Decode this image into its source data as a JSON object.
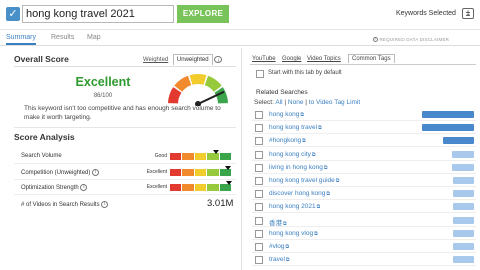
{
  "header": {
    "search_value": "hong kong travel 2021",
    "explore_label": "EXPLORE",
    "keywords_selected_label": "Keywords Selected",
    "keywords_selected_count": "1"
  },
  "tabs": [
    "Summary",
    "Results",
    "Map"
  ],
  "disclaimer": "REQUIRED DATA DISCLAIMER",
  "overall": {
    "title": "Overall Score",
    "weighted_label": "Weighted",
    "unweighted_label": "Unweighted",
    "rating": "Excellent",
    "score": "86/100",
    "score_value": 86,
    "description": "This keyword isn't too competitive and has enough search volume to make it worth targeting."
  },
  "analysis": {
    "title": "Score Analysis",
    "rows": [
      {
        "label": "Search Volume",
        "rating": "Good",
        "level": 0.74
      },
      {
        "label": "Competition (Unweighted)",
        "rating": "Excellent",
        "level": 0.93
      },
      {
        "label": "Optimization Strength",
        "rating": "Excellent",
        "level": 0.95
      }
    ],
    "videos_label": "# of Videos in Search Results",
    "videos_value": "3.01M"
  },
  "right": {
    "tabs": [
      "YouTube",
      "Google",
      "Video Topics",
      "Common Tags"
    ],
    "start_label": "Start with this tab by default",
    "related_title": "Related Searches",
    "select_prefix": "Select:",
    "select_all": "All",
    "select_sep": "|",
    "select_none": "None",
    "select_limit": "to Video Tag Limit",
    "keywords": [
      {
        "text": "hong kong",
        "vol": 1.0,
        "ext": true
      },
      {
        "text": "hong kong travel",
        "vol": 1.0,
        "ext": true
      },
      {
        "text": "#hongkong",
        "vol": 0.6,
        "ext": true
      },
      {
        "text": "hong kong city",
        "vol": 0.42,
        "ext": true
      },
      {
        "text": "living in hong kong",
        "vol": 0.42,
        "ext": true
      },
      {
        "text": "hong kong travel guide",
        "vol": 0.4,
        "ext": true
      },
      {
        "text": "discover hong kong",
        "vol": 0.4,
        "ext": true
      },
      {
        "text": "hong kong 2021",
        "vol": 0.4,
        "ext": true
      },
      {
        "text": "香港",
        "vol": 0.4,
        "ext": true
      },
      {
        "text": "hong kong vlog",
        "vol": 0.4,
        "ext": true
      },
      {
        "text": "#vlog",
        "vol": 0.4,
        "ext": true
      },
      {
        "text": "travel",
        "vol": 0.4,
        "ext": true
      }
    ]
  },
  "colors": {
    "accent": "#3a7fc0",
    "explore": "#79c45a",
    "excellent": "#2f9a2f",
    "volume_dark": "#4a88cc",
    "volume_light": "#a9c9ec"
  }
}
